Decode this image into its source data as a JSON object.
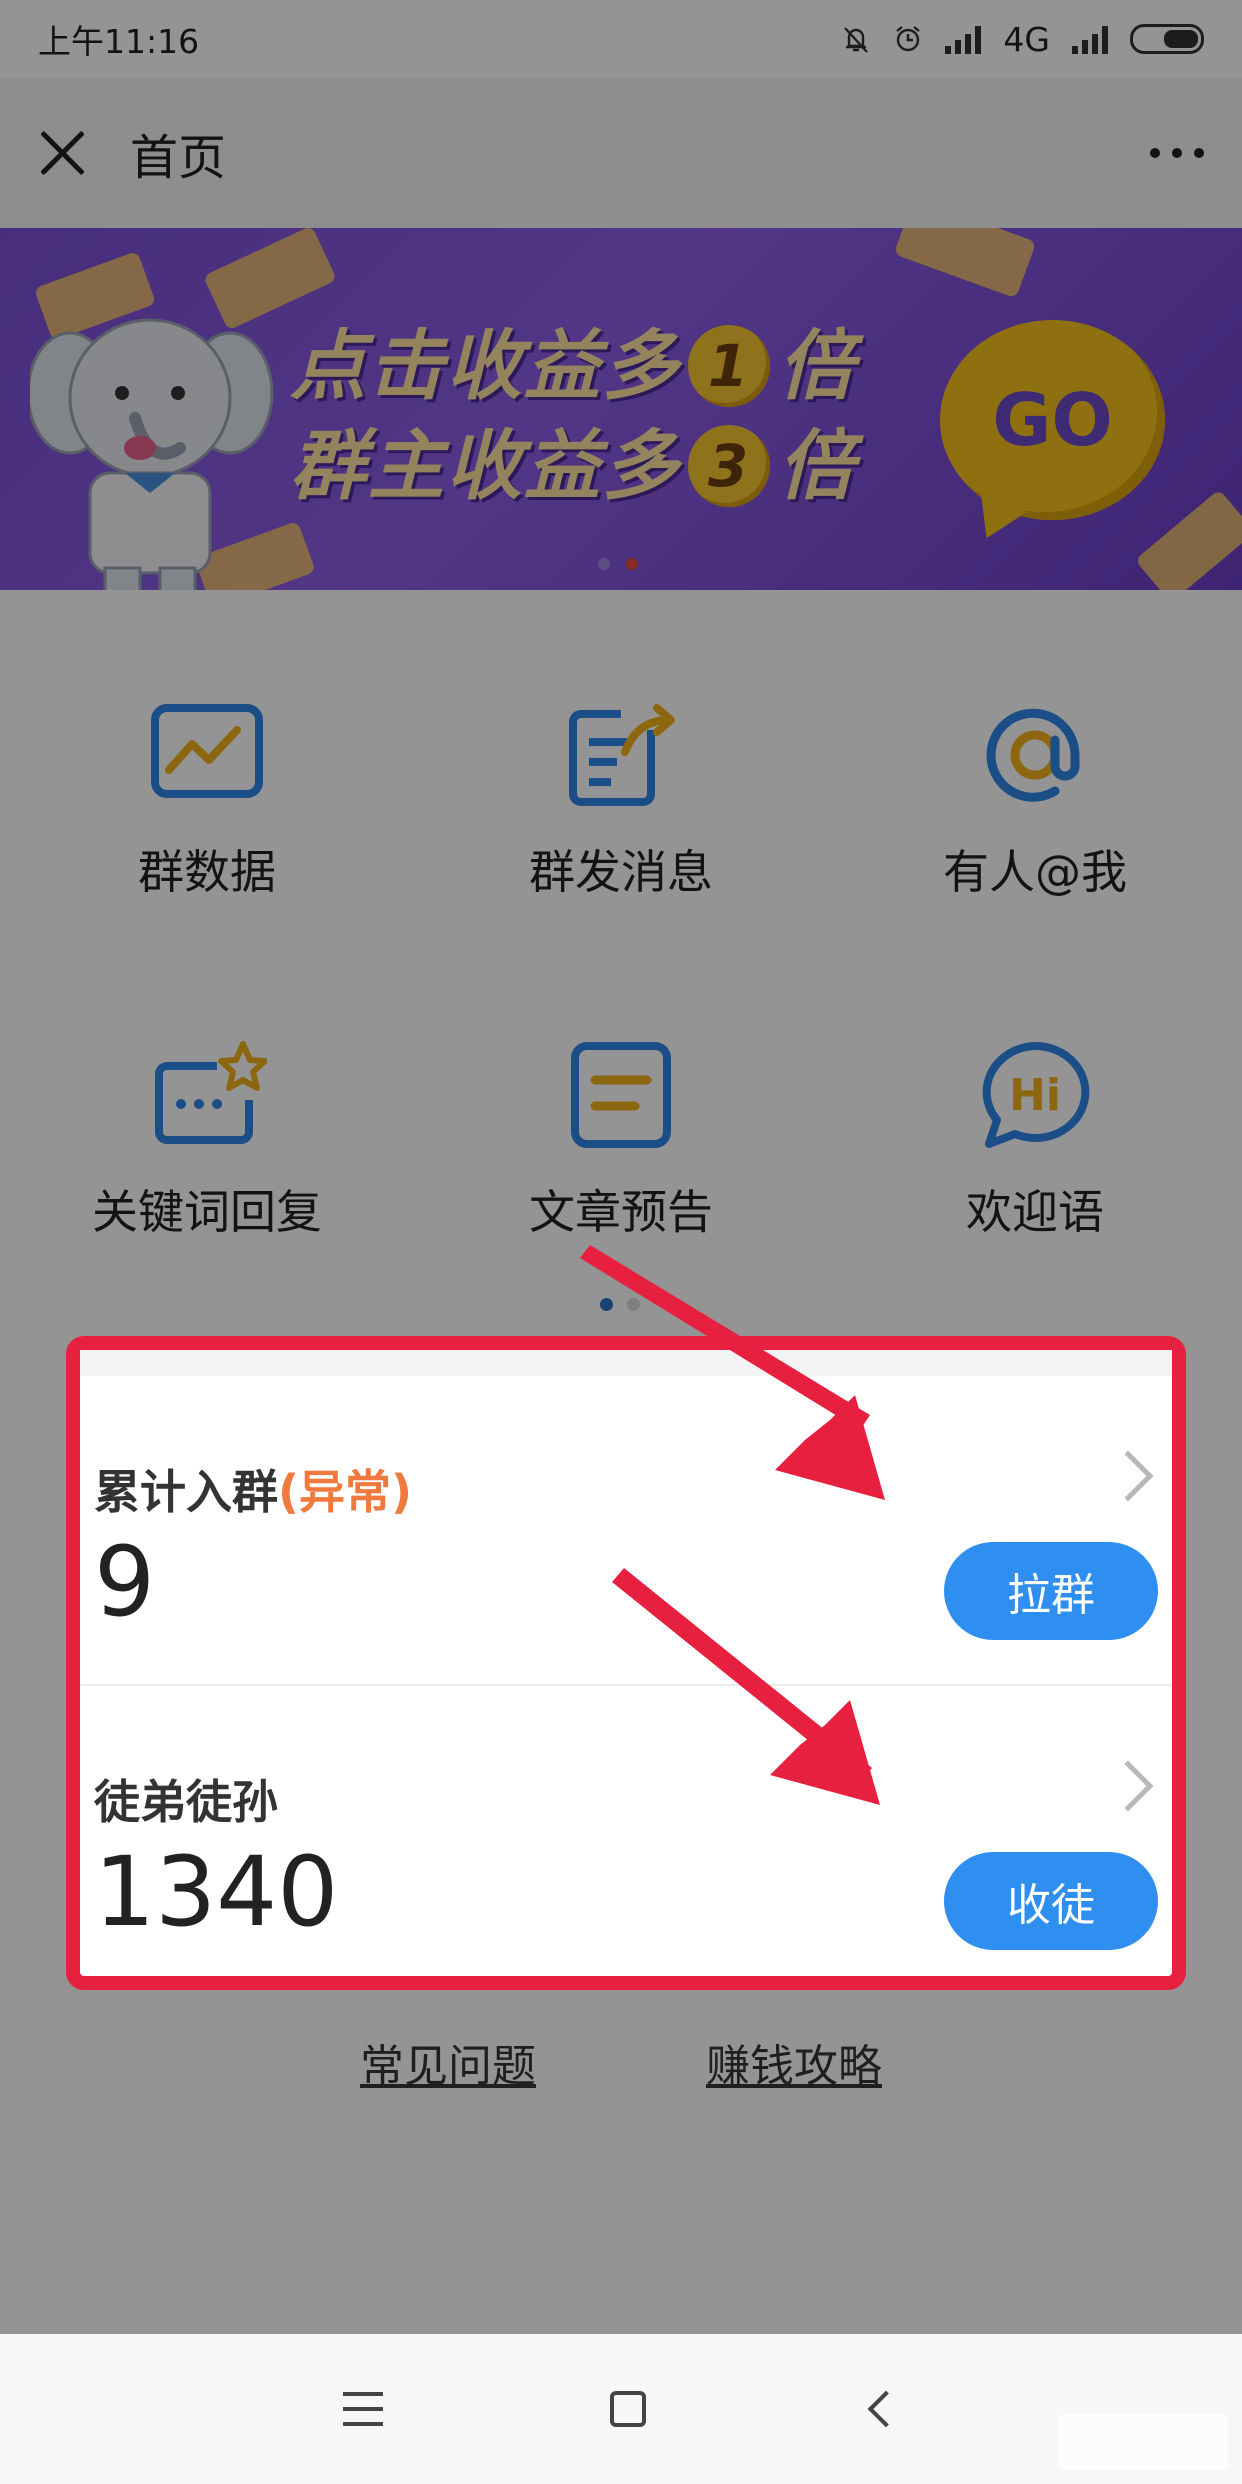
{
  "status_bar": {
    "time": "上午11:16",
    "network": "4G"
  },
  "nav": {
    "title": "首页"
  },
  "banner": {
    "line1_a": "点击收益多",
    "line1_num": "1",
    "line1_b": "倍",
    "line2_a": "群主收益多",
    "line2_num": "3",
    "line2_b": "倍",
    "go_label": "GO"
  },
  "grid": {
    "items": [
      {
        "label": "群数据",
        "icon": "chart-icon"
      },
      {
        "label": "群发消息",
        "icon": "broadcast-icon"
      },
      {
        "label": "有人@我",
        "icon": "at-icon"
      },
      {
        "label": "关键词回复",
        "icon": "keyword-reply-icon"
      },
      {
        "label": "文章预告",
        "icon": "article-icon"
      },
      {
        "label": "欢迎语",
        "icon": "hi-bubble-icon"
      }
    ]
  },
  "stats": {
    "joined": {
      "label": "累计入群",
      "warning": "(异常)",
      "value": "9",
      "button": "拉群"
    },
    "disciples": {
      "label": "徒弟徒孙",
      "value": "1340",
      "button": "收徒"
    }
  },
  "links": {
    "faq": "常见问题",
    "guide": "赚钱攻略"
  },
  "colors": {
    "accent_blue": "#2f8ff0",
    "highlight_red": "#e8203f",
    "warning_orange": "#f07a3e",
    "banner_purple": "#7b4fd6"
  }
}
